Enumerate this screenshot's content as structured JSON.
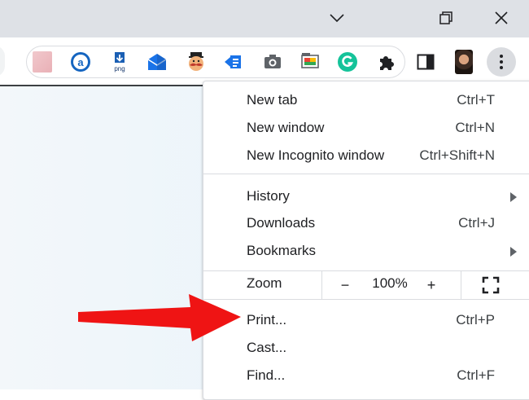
{
  "window": {
    "controls": {
      "minimize_icon": "chevron-down-icon",
      "restore_icon": "restore-icon",
      "close_icon": "close-icon"
    }
  },
  "toolbar": {
    "extensions": [
      "extension-pink-square-icon",
      "extension-a-circle-icon",
      "extension-png-download-icon",
      "extension-mail-icon",
      "extension-mustache-face-icon",
      "extension-arrow-doc-icon",
      "extension-camera-icon",
      "extension-screen-capture-icon",
      "extension-grammarly-icon",
      "extensions-puzzle-icon",
      "side-panel-icon",
      "profile-avatar-icon",
      "more-vertical-icon"
    ]
  },
  "menu": {
    "group1": [
      {
        "label": "New tab",
        "shortcut": "Ctrl+T"
      },
      {
        "label": "New window",
        "shortcut": "Ctrl+N"
      },
      {
        "label": "New Incognito window",
        "shortcut": "Ctrl+Shift+N"
      }
    ],
    "group2": [
      {
        "label": "History",
        "shortcut": ""
      },
      {
        "label": "Downloads",
        "shortcut": "Ctrl+J"
      },
      {
        "label": "Bookmarks",
        "shortcut": ""
      }
    ],
    "zoom": {
      "label": "Zoom",
      "minus": "−",
      "value": "100%",
      "plus": "+"
    },
    "group3": [
      {
        "label": "Print...",
        "shortcut": "Ctrl+P"
      },
      {
        "label": "Cast...",
        "shortcut": ""
      },
      {
        "label": "Find...",
        "shortcut": "Ctrl+F"
      }
    ]
  },
  "colors": {
    "annotation_arrow": "#ef1414",
    "titlebar": "#dee1e6",
    "grammarly": "#15c39a",
    "accent_blue": "#1a73e8"
  }
}
